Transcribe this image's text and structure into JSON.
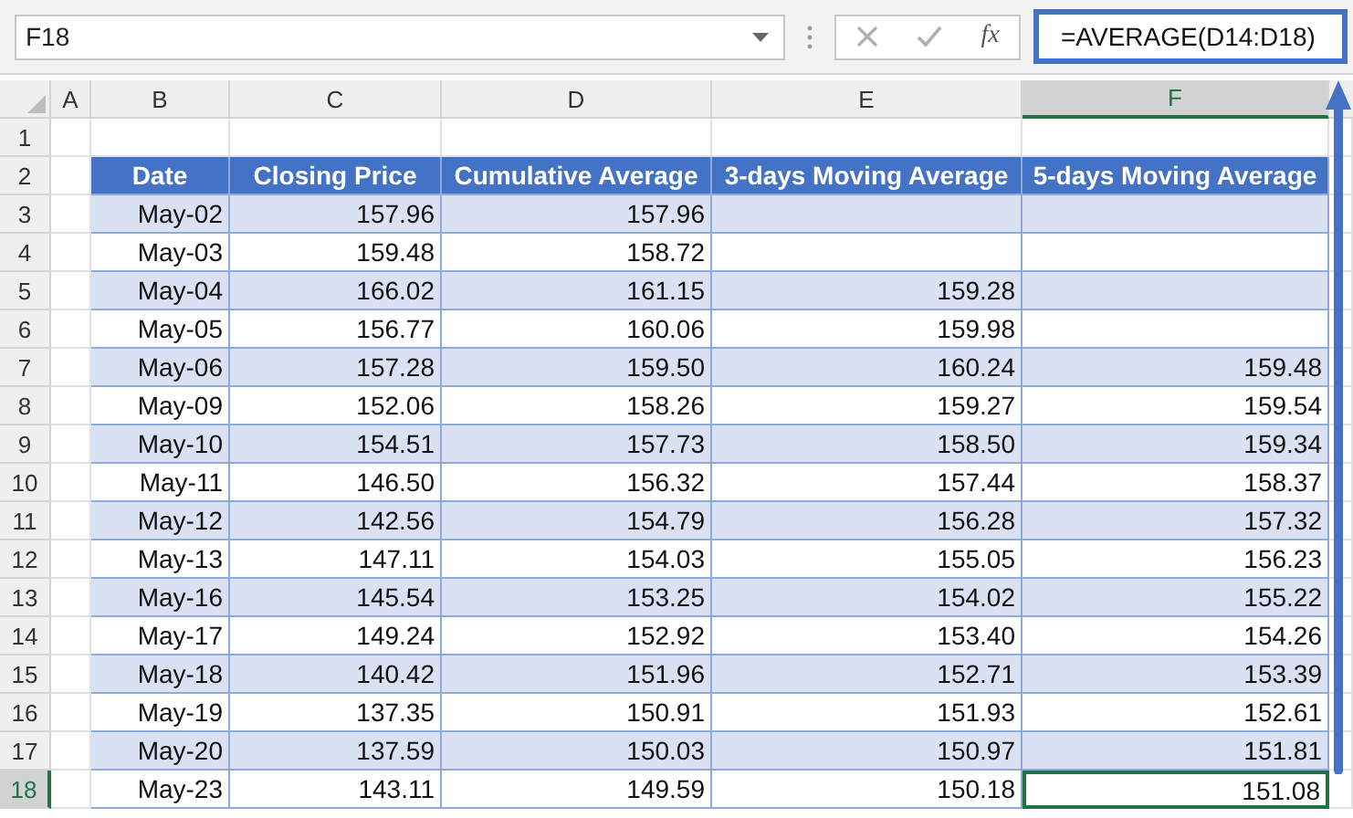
{
  "formula_bar": {
    "name_box": "F18",
    "function_label": "fx",
    "formula": "=AVERAGE(D14:D18)"
  },
  "columns": [
    {
      "label": "A",
      "selected": false
    },
    {
      "label": "B",
      "selected": false
    },
    {
      "label": "C",
      "selected": false
    },
    {
      "label": "D",
      "selected": false
    },
    {
      "label": "E",
      "selected": false
    },
    {
      "label": "F",
      "selected": true
    }
  ],
  "row_headers": [
    {
      "label": "1",
      "selected": false
    },
    {
      "label": "2",
      "selected": false
    },
    {
      "label": "3",
      "selected": false
    },
    {
      "label": "4",
      "selected": false
    },
    {
      "label": "5",
      "selected": false
    },
    {
      "label": "6",
      "selected": false
    },
    {
      "label": "7",
      "selected": false
    },
    {
      "label": "8",
      "selected": false
    },
    {
      "label": "9",
      "selected": false
    },
    {
      "label": "10",
      "selected": false
    },
    {
      "label": "11",
      "selected": false
    },
    {
      "label": "12",
      "selected": false
    },
    {
      "label": "13",
      "selected": false
    },
    {
      "label": "14",
      "selected": false
    },
    {
      "label": "15",
      "selected": false
    },
    {
      "label": "16",
      "selected": false
    },
    {
      "label": "17",
      "selected": false
    },
    {
      "label": "18",
      "selected": true
    }
  ],
  "table": {
    "headers": [
      "Date",
      "Closing Price",
      "Cumulative Average",
      "3-days Moving Average",
      "5-days Moving Average"
    ],
    "rows": [
      {
        "date": "May-02",
        "closing_price": "157.96",
        "cumulative_average": "157.96"
      },
      {
        "date": "May-03",
        "closing_price": "159.48",
        "cumulative_average": "158.72"
      },
      {
        "date": "May-04",
        "closing_price": "166.02",
        "cumulative_average": "161.15",
        "ma3": "159.28"
      },
      {
        "date": "May-05",
        "closing_price": "156.77",
        "cumulative_average": "160.06",
        "ma3": "159.98"
      },
      {
        "date": "May-06",
        "closing_price": "157.28",
        "cumulative_average": "159.50",
        "ma3": "160.24",
        "ma5": "159.48"
      },
      {
        "date": "May-09",
        "closing_price": "152.06",
        "cumulative_average": "158.26",
        "ma3": "159.27",
        "ma5": "159.54"
      },
      {
        "date": "May-10",
        "closing_price": "154.51",
        "cumulative_average": "157.73",
        "ma3": "158.50",
        "ma5": "159.34"
      },
      {
        "date": "May-11",
        "closing_price": "146.50",
        "cumulative_average": "156.32",
        "ma3": "157.44",
        "ma5": "158.37"
      },
      {
        "date": "May-12",
        "closing_price": "142.56",
        "cumulative_average": "154.79",
        "ma3": "156.28",
        "ma5": "157.32"
      },
      {
        "date": "May-13",
        "closing_price": "147.11",
        "cumulative_average": "154.03",
        "ma3": "155.05",
        "ma5": "156.23"
      },
      {
        "date": "May-16",
        "closing_price": "145.54",
        "cumulative_average": "153.25",
        "ma3": "154.02",
        "ma5": "155.22"
      },
      {
        "date": "May-17",
        "closing_price": "149.24",
        "cumulative_average": "152.92",
        "ma3": "153.40",
        "ma5": "154.26"
      },
      {
        "date": "May-18",
        "closing_price": "140.42",
        "cumulative_average": "151.96",
        "ma3": "152.71",
        "ma5": "153.39"
      },
      {
        "date": "May-19",
        "closing_price": "137.35",
        "cumulative_average": "150.91",
        "ma3": "151.93",
        "ma5": "152.61"
      },
      {
        "date": "May-20",
        "closing_price": "137.59",
        "cumulative_average": "150.03",
        "ma3": "150.97",
        "ma5": "151.81"
      },
      {
        "date": "May-23",
        "closing_price": "143.11",
        "cumulative_average": "149.59",
        "ma3": "150.18",
        "ma5": "151.08"
      }
    ]
  }
}
